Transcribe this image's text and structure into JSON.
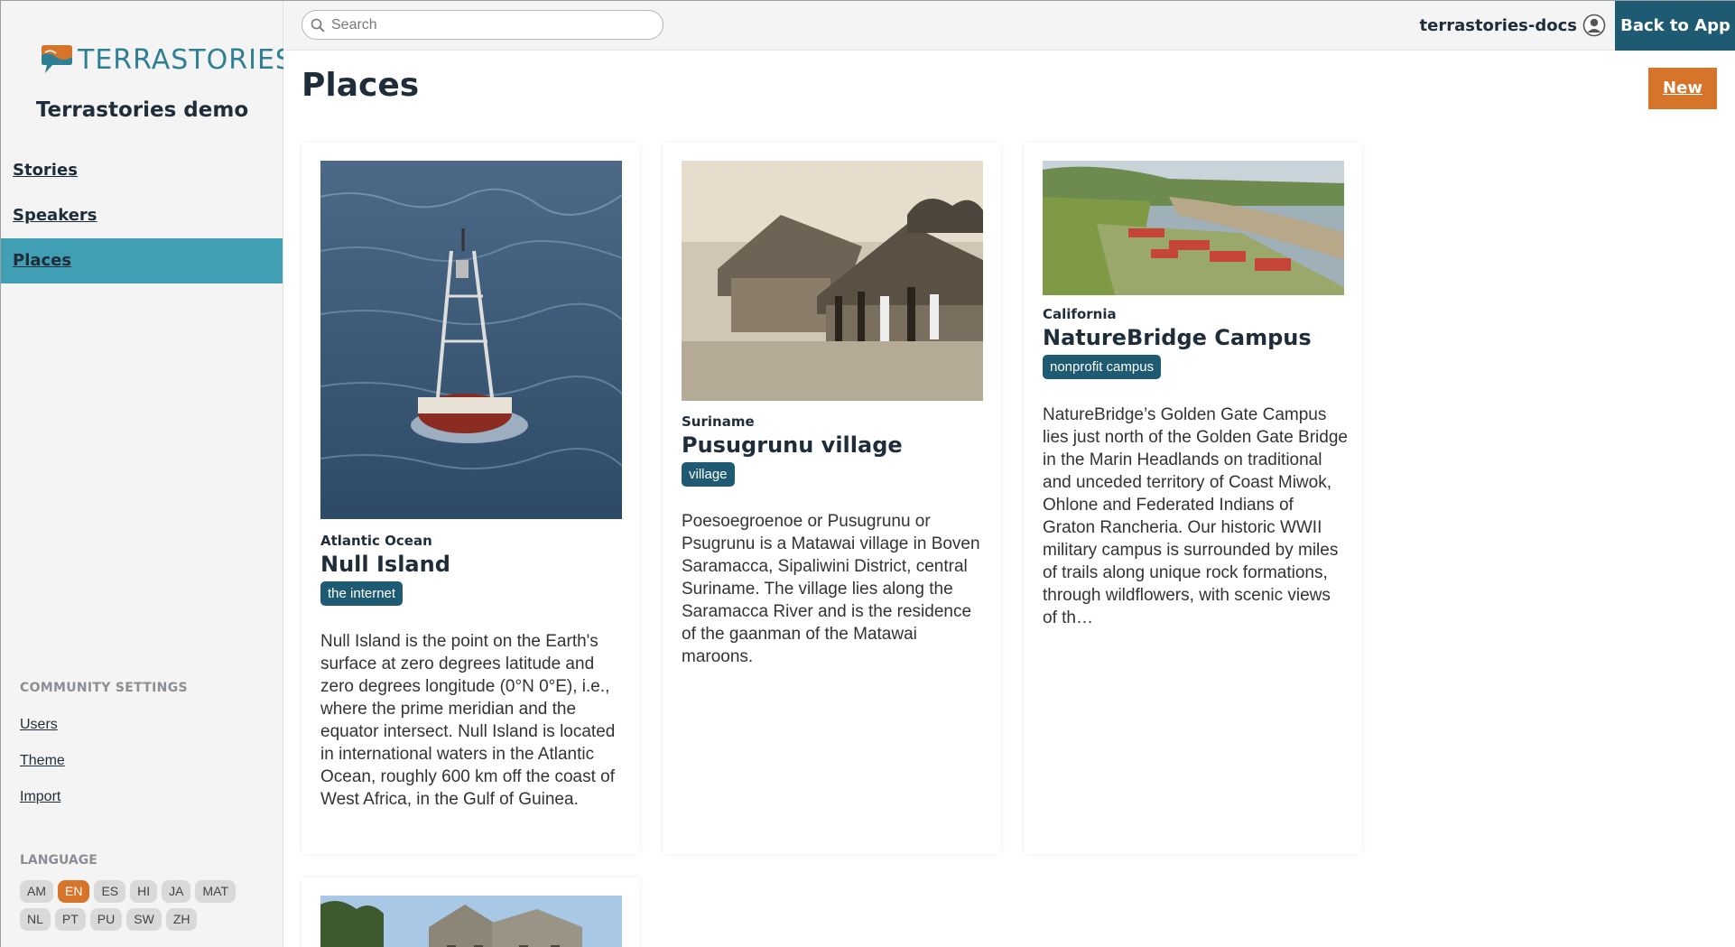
{
  "sidebar": {
    "logo_text": "TERRASTORIES",
    "community_name": "Terrastories demo",
    "nav": [
      {
        "label": "Stories"
      },
      {
        "label": "Speakers"
      },
      {
        "label": "Places"
      }
    ],
    "settings_heading": "COMMUNITY SETTINGS",
    "settings_links": [
      {
        "label": "Users"
      },
      {
        "label": "Theme"
      },
      {
        "label": "Import"
      }
    ],
    "language_heading": "LANGUAGE",
    "languages": [
      "AM",
      "EN",
      "ES",
      "HI",
      "JA",
      "MAT",
      "NL",
      "PT",
      "PU",
      "SW",
      "ZH"
    ],
    "active_language": "EN"
  },
  "topbar": {
    "search_placeholder": "Search",
    "username": "terrastories-docs",
    "back_button": "Back to App"
  },
  "main": {
    "title": "Places",
    "new_button": "New",
    "places": [
      {
        "region": "Atlantic Ocean",
        "name": "Null Island",
        "type": "the internet",
        "description": "Null Island is the point on the Earth's surface at zero degrees latitude and zero degrees longitude (0°N 0°E), i.e., where the prime meridian and the equator intersect. Null Island is located in international waters in the Atlantic Ocean, roughly 600 km off the coast of West Africa, in the Gulf of Guinea."
      },
      {
        "region": "Suriname",
        "name": "Pusugrunu village",
        "type": "village",
        "description": "Poesoegroenoe or Pusugrunu or Psugrunu is a Matawai village in Boven Saramacca, Sipaliwini District, central Suriname. The village lies along the Saramacca River and is the residence of the gaanman of the Matawai maroons."
      },
      {
        "region": "California",
        "name": "NatureBridge Campus",
        "type": "nonprofit campus",
        "description": "NatureBridge’s Golden Gate Campus lies just north of the Golden Gate Bridge in the Marin Headlands on traditional and unceded territory of Coast Miwok, Ohlone and Federated Indians of Graton Rancheria. Our historic WWII military campus is surrounded by miles of trails along unique rock formations, through wildflowers, with scenic views of th…"
      }
    ]
  },
  "colors": {
    "accent_teal": "#409fb2",
    "dark_blue": "#1e5a72",
    "orange": "#d6752a"
  }
}
